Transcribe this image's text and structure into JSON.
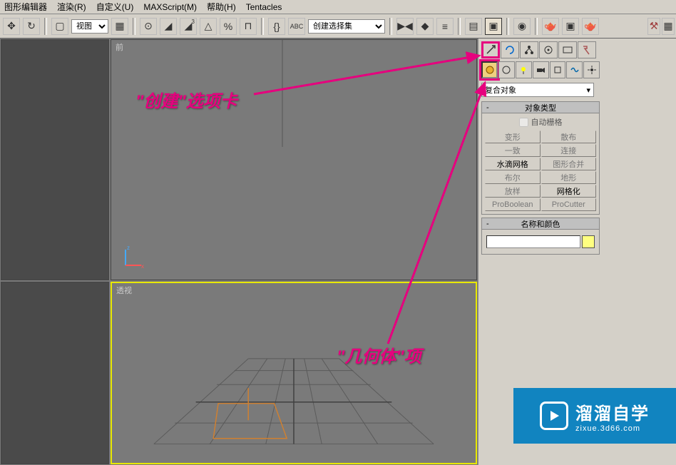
{
  "menu": {
    "items": [
      "图形编辑器",
      "渲染(R)",
      "自定义(U)",
      "MAXScript(M)",
      "帮助(H)",
      "Tentacles"
    ]
  },
  "toolbar": {
    "view_dropdown": "视图",
    "create_set_dropdown": "创建选择集"
  },
  "viewports": {
    "front_label": "前",
    "perspective_label": "透视"
  },
  "annotations": {
    "create_tab": "\"创建\"选项卡",
    "geometry_item": "\"几何体\"项"
  },
  "command_panel": {
    "category_dropdown": "复合对象",
    "object_type_rollout": "对象类型",
    "auto_grid": "自动栅格",
    "buttons": [
      {
        "label": "变形",
        "enabled": false
      },
      {
        "label": "散布",
        "enabled": false
      },
      {
        "label": "一致",
        "enabled": false
      },
      {
        "label": "连接",
        "enabled": false
      },
      {
        "label": "水滴网格",
        "enabled": true
      },
      {
        "label": "图形合并",
        "enabled": false
      },
      {
        "label": "布尔",
        "enabled": false
      },
      {
        "label": "地形",
        "enabled": false
      },
      {
        "label": "放样",
        "enabled": false
      },
      {
        "label": "网格化",
        "enabled": true
      },
      {
        "label": "ProBoolean",
        "enabled": false
      },
      {
        "label": "ProCutter",
        "enabled": false
      }
    ],
    "name_color_rollout": "名称和颜色"
  },
  "watermark": {
    "title": "溜溜自学",
    "url": "zixue.3d66.com"
  }
}
